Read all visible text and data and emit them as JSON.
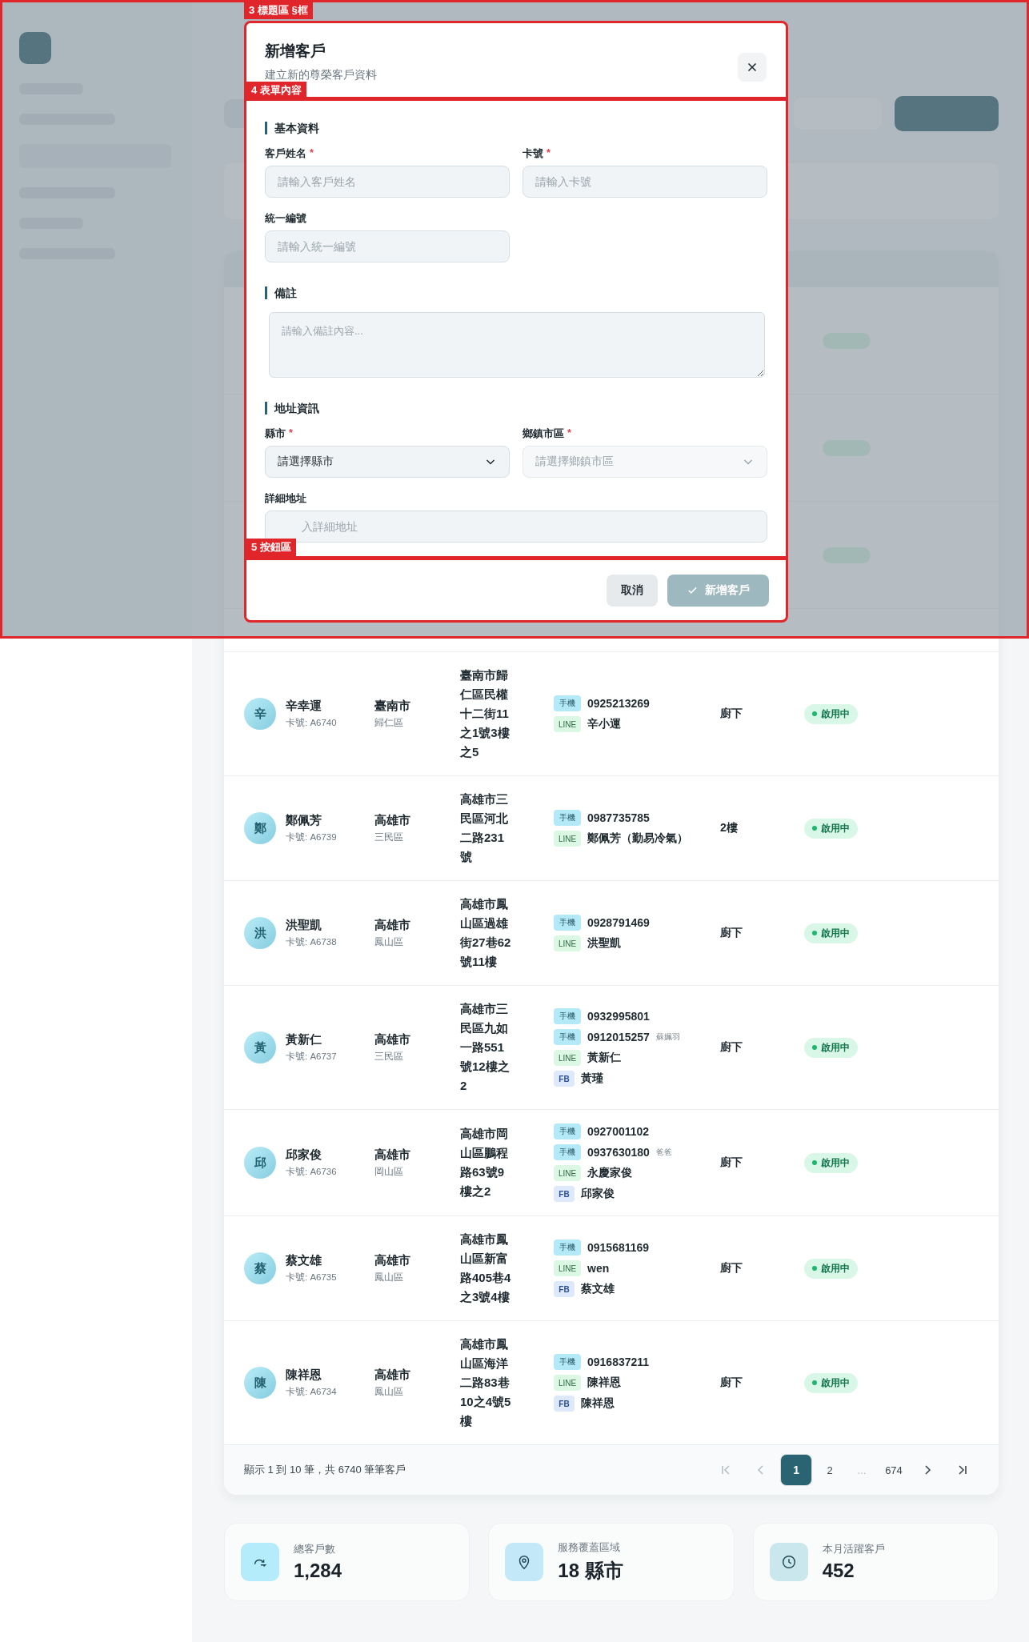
{
  "annotations": [
    {
      "label": "3 標題區 §框"
    },
    {
      "label": "4 表單內容"
    },
    {
      "label": "5 按鈕區"
    }
  ],
  "modal": {
    "title": "新增客戶",
    "subtitle": "建立新的尊榮客戶資料",
    "sections": [
      {
        "heading": "基本資料",
        "kind": "grid",
        "fields": [
          {
            "label": "客戶姓名",
            "required_mark": "*",
            "kind": "input",
            "placeholder": "請輸入客戶姓名"
          },
          {
            "label": "卡號",
            "required_mark": "*",
            "kind": "input",
            "placeholder": "請輸入卡號"
          },
          {
            "label": "統一編號",
            "kind": "input",
            "placeholder": "請輸入統一編號"
          }
        ]
      },
      {
        "heading": "備註",
        "kind": "full",
        "fields": [
          {
            "kind": "textarea",
            "placeholder": "請輸入備註內容..."
          }
        ]
      },
      {
        "heading": "地址資訊",
        "kind": "grid",
        "fields": [
          {
            "label": "縣市",
            "required_mark": "*",
            "kind": "select",
            "value": "請選擇縣市",
            "disabled": false
          },
          {
            "label": "鄉鎮市區",
            "required_mark": "*",
            "kind": "select",
            "value": "請選擇鄉鎮市區",
            "disabled": true
          },
          {
            "label": "詳細地址",
            "kind": "input",
            "placeholder": "入詳細地址",
            "wide": true
          }
        ]
      }
    ],
    "buttons": [
      {
        "label": "取消",
        "kind": "cancel",
        "disabled": false
      },
      {
        "label": "新增客戶",
        "kind": "submit",
        "disabled": true
      }
    ]
  },
  "table": {
    "rows": [
      {
        "initial": "辛",
        "name": "辛幸運",
        "card": "卡號: A6740",
        "city": "臺南市",
        "district": "歸仁區",
        "address": "臺南市歸仁區民權十二街11之1號3樓之5",
        "contacts": [
          {
            "kind": "mobile",
            "tag": "手機",
            "value": "0925213269"
          },
          {
            "kind": "line",
            "tag": "LINE",
            "value": "辛小運"
          }
        ],
        "floor": "廚下",
        "status": {
          "kind": "active",
          "label": "啟用中"
        }
      },
      {
        "initial": "鄭",
        "name": "鄭佩芳",
        "card": "卡號: A6739",
        "city": "高雄市",
        "district": "三民區",
        "address": "高雄市三民區河北二路231號",
        "contacts": [
          {
            "kind": "mobile",
            "tag": "手機",
            "value": "0987735785"
          },
          {
            "kind": "line",
            "tag": "LINE",
            "value": "鄭佩芳（勤易冷氣）"
          }
        ],
        "floor": "2樓",
        "status": {
          "kind": "active",
          "label": "啟用中"
        }
      },
      {
        "initial": "洪",
        "name": "洪聖凱",
        "card": "卡號: A6738",
        "city": "高雄市",
        "district": "鳳山區",
        "address": "高雄市鳳山區過雄街27巷62號11樓",
        "contacts": [
          {
            "kind": "mobile",
            "tag": "手機",
            "value": "0928791469"
          },
          {
            "kind": "line",
            "tag": "LINE",
            "value": "洪聖凱"
          }
        ],
        "floor": "廚下",
        "status": {
          "kind": "active",
          "label": "啟用中"
        }
      },
      {
        "initial": "黃",
        "name": "黃新仁",
        "card": "卡號: A6737",
        "city": "高雄市",
        "district": "三民區",
        "address": "高雄市三民區九如一路551號12樓之2",
        "contacts": [
          {
            "kind": "mobile",
            "tag": "手機",
            "value": "0932995801"
          },
          {
            "kind": "mobile",
            "tag": "手機",
            "value": "0912015257",
            "note": "蘇姵羽"
          },
          {
            "kind": "line",
            "tag": "LINE",
            "value": "黃新仁"
          },
          {
            "kind": "fb",
            "tag": "FB",
            "value": "黃瑾"
          }
        ],
        "floor": "廚下",
        "status": {
          "kind": "active",
          "label": "啟用中"
        }
      },
      {
        "initial": "邱",
        "name": "邱家俊",
        "card": "卡號: A6736",
        "city": "高雄市",
        "district": "岡山區",
        "address": "高雄市岡山區鵬程路63號9樓之2",
        "contacts": [
          {
            "kind": "mobile",
            "tag": "手機",
            "value": "0927001102"
          },
          {
            "kind": "mobile",
            "tag": "手機",
            "value": "0937630180",
            "note": "爸爸"
          },
          {
            "kind": "line",
            "tag": "LINE",
            "value": "永慶家俊"
          },
          {
            "kind": "fb",
            "tag": "FB",
            "value": "邱家俊"
          }
        ],
        "floor": "廚下",
        "status": {
          "kind": "active",
          "label": "啟用中"
        }
      },
      {
        "initial": "蔡",
        "name": "蔡文雄",
        "card": "卡號: A6735",
        "city": "高雄市",
        "district": "鳳山區",
        "address": "高雄市鳳山區新富路405巷4之3號4樓",
        "contacts": [
          {
            "kind": "mobile",
            "tag": "手機",
            "value": "0915681169"
          },
          {
            "kind": "line",
            "tag": "LINE",
            "value": "wen"
          },
          {
            "kind": "fb",
            "tag": "FB",
            "value": "蔡文雄"
          }
        ],
        "floor": "廚下",
        "status": {
          "kind": "active",
          "label": "啟用中"
        }
      },
      {
        "initial": "陳",
        "name": "陳祥恩",
        "card": "卡號: A6734",
        "city": "高雄市",
        "district": "鳳山區",
        "address": "高雄市鳳山區海洋二路83巷10之4號5樓",
        "contacts": [
          {
            "kind": "mobile",
            "tag": "手機",
            "value": "0916837211"
          },
          {
            "kind": "line",
            "tag": "LINE",
            "value": "陳祥恩"
          },
          {
            "kind": "fb",
            "tag": "FB",
            "value": "陳祥恩"
          }
        ],
        "floor": "廚下",
        "status": {
          "kind": "active",
          "label": "啟用中"
        }
      }
    ],
    "summary": "顯示 1 到 10 筆，共 6740 筆筆客戶",
    "pages": [
      {
        "kind": "first",
        "disabled": true
      },
      {
        "kind": "prev",
        "disabled": true
      },
      {
        "kind": "page",
        "label": "1",
        "selected": true
      },
      {
        "kind": "page",
        "label": "2",
        "selected": false
      },
      {
        "kind": "ellipsis",
        "label": "..."
      },
      {
        "kind": "page",
        "label": "674",
        "selected": false
      },
      {
        "kind": "next",
        "disabled": false
      },
      {
        "kind": "last",
        "disabled": false
      }
    ]
  },
  "stats": [
    {
      "kind": "customers",
      "label": "總客戶數",
      "value": "1,284"
    },
    {
      "kind": "area",
      "label": "服務覆蓋區域",
      "value": "18 縣市"
    },
    {
      "kind": "active",
      "label": "本月活躍客戶",
      "value": "452"
    }
  ]
}
